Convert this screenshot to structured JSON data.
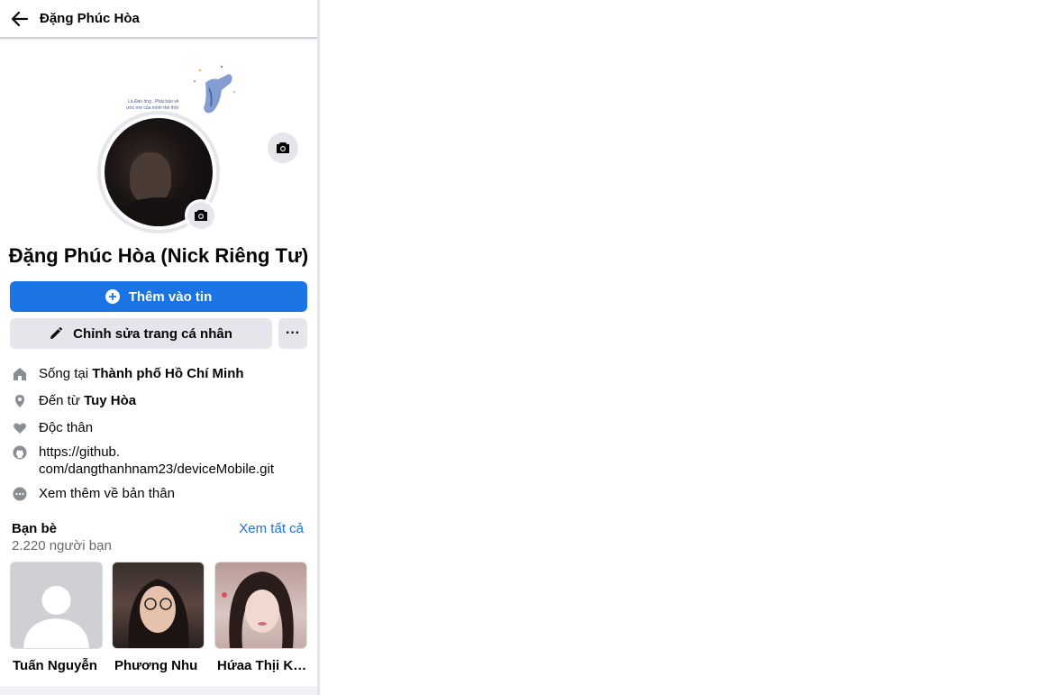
{
  "header": {
    "title": "Đặng Phúc Hòa",
    "back_icon": "arrow-left-icon"
  },
  "profile": {
    "name": "Đặng Phúc Hòa (Nick Riêng Tư)",
    "cover_caption_line1": "Là Đàn ông , Phải bảo về",
    "cover_caption_line2": "ước mơ của mình thế thôi"
  },
  "actions": {
    "add_story_label": "Thêm vào tin",
    "edit_profile_label": "Chỉnh sửa trang cá nhân",
    "more_label": "···"
  },
  "details": {
    "lives_prefix": "Sống tại ",
    "lives_value": "Thành phố Hồ Chí Minh",
    "from_prefix": "Đến từ ",
    "from_value": "Tuy Hòa",
    "relationship": "Độc thân",
    "website_line1": "https://github.",
    "website_line2": "com/dangthanhnam23/deviceMobile.git",
    "see_more": "Xem thêm về bản thân"
  },
  "friends": {
    "title": "Bạn bè",
    "see_all": "Xem tất cả",
    "count": "2.220 người bạn",
    "items": [
      {
        "name": "Tuấn Nguyễn"
      },
      {
        "name": "Phương Nhu"
      },
      {
        "name": "Hứaa Thịi Kiềuu"
      }
    ]
  },
  "colors": {
    "primary": "#1b74e4",
    "link": "#216fdb",
    "secondary_bg": "#e4e6eb",
    "muted_text": "#65676b"
  }
}
